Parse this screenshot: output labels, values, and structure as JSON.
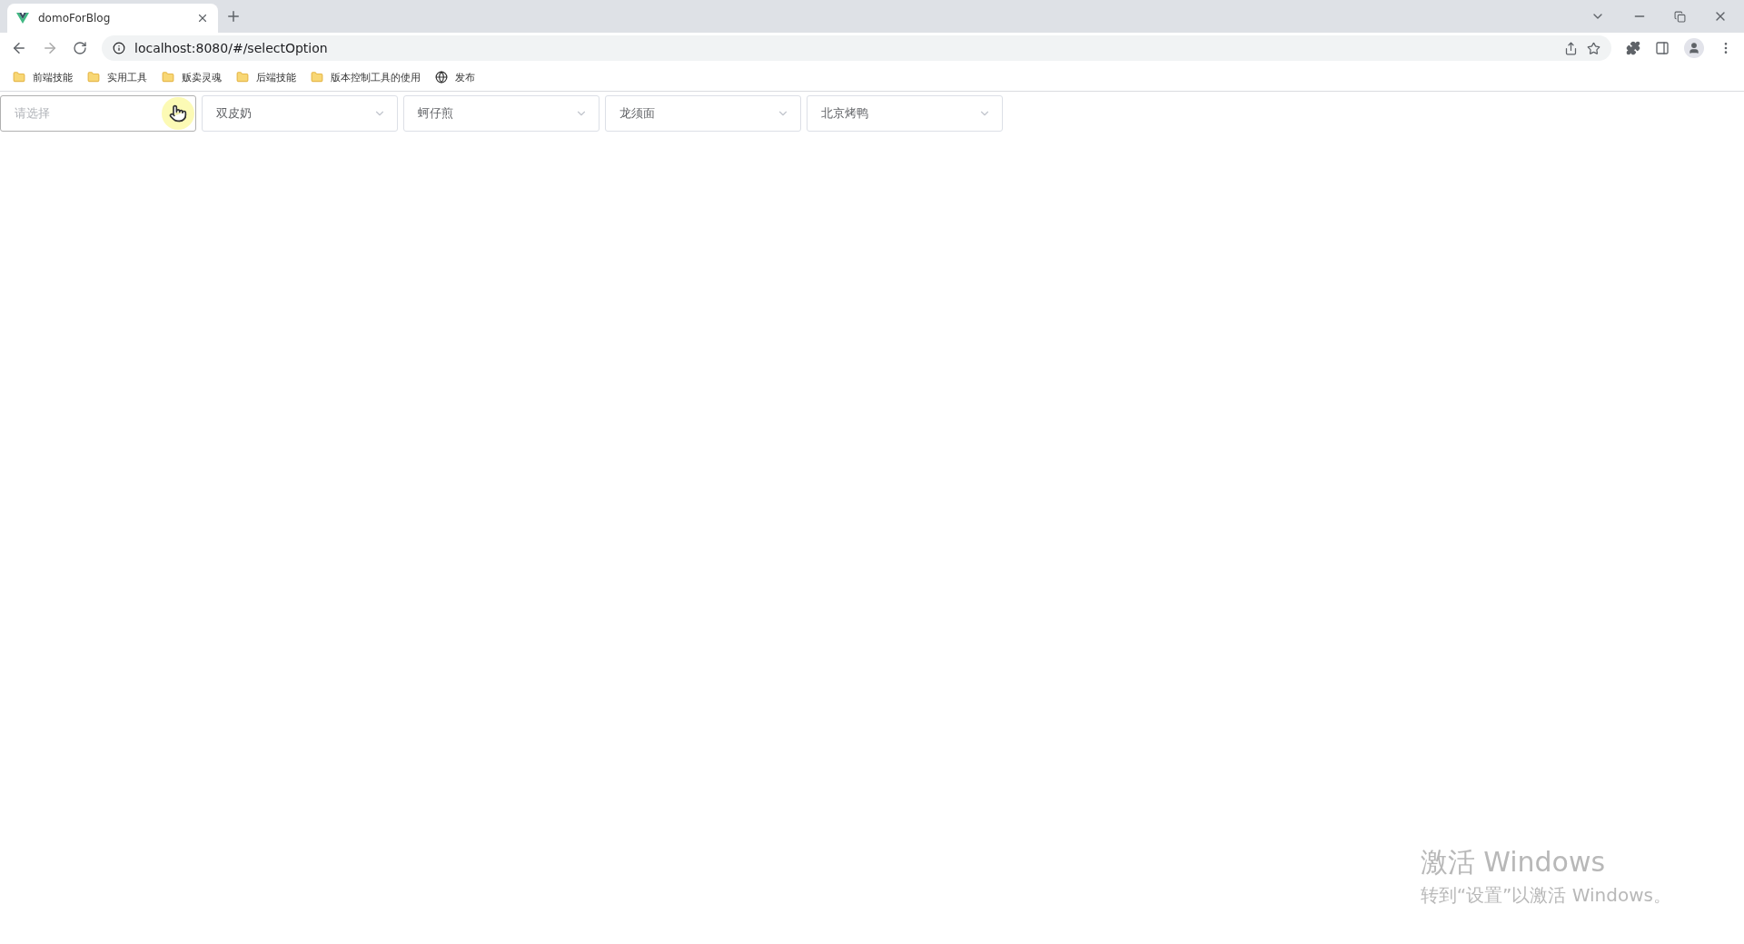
{
  "browser": {
    "tabs": [
      {
        "title": "domoForBlog",
        "selected": true
      }
    ],
    "address": "localhost:8080/#/selectOption",
    "bookmarks": [
      {
        "kind": "folder",
        "label": "前端技能"
      },
      {
        "kind": "folder",
        "label": "实用工具"
      },
      {
        "kind": "folder",
        "label": "贩卖灵魂"
      },
      {
        "kind": "folder",
        "label": "后端技能"
      },
      {
        "kind": "folder",
        "label": "版本控制工具的使用"
      },
      {
        "kind": "site",
        "label": "发布"
      }
    ]
  },
  "selects": [
    {
      "placeholder": "请选择",
      "hovered": true
    },
    {
      "value": "双皮奶",
      "hovered": false
    },
    {
      "value": "蚵仔煎",
      "hovered": false
    },
    {
      "value": "龙须面",
      "hovered": false
    },
    {
      "value": "北京烤鸭",
      "hovered": false
    }
  ],
  "os_overlay": {
    "title": "激活 Windows",
    "subtitle": "转到“设置”以激活 Windows。"
  }
}
